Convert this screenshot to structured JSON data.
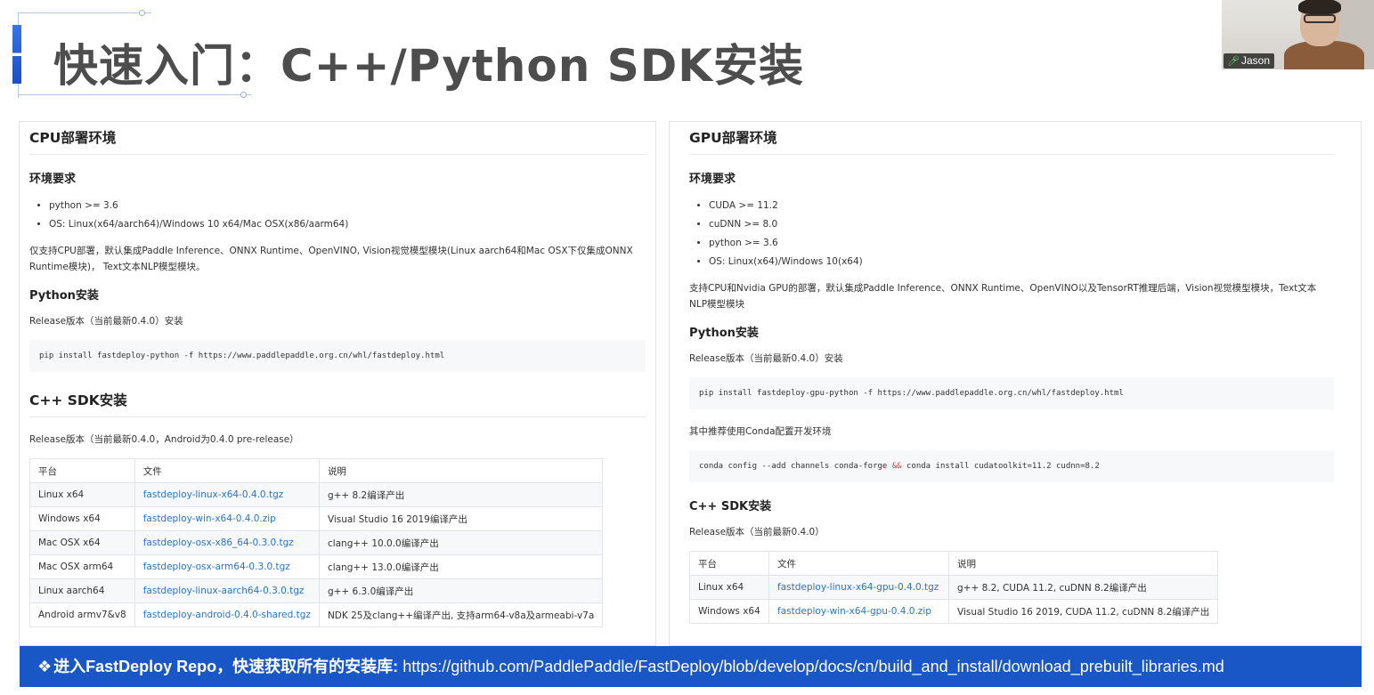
{
  "page": {
    "title": "快速入门：C++/Python SDK安装",
    "accent_color": "#1a57c6"
  },
  "webcam": {
    "participant_name": "Jason",
    "mic_icon": "mic-icon"
  },
  "cpu": {
    "heading": "CPU部署环境",
    "env_heading": "环境要求",
    "requirements": [
      "python >= 3.6",
      "OS: Linux(x64/aarch64)/Windows 10 x64/Mac OSX(x86/aarm64)"
    ],
    "description": "仅支持CPU部署，默认集成Paddle Inference、ONNX Runtime、OpenVINO, Vision视觉模型模块(Linux aarch64和Mac OSX下仅集成ONNX Runtime模块)， Text文本NLP模型模块。",
    "python_heading": "Python安装",
    "python_release": "Release版本（当前最新0.4.0）安装",
    "python_cmd": "pip install fastdeploy-python -f https://www.paddlepaddle.org.cn/whl/fastdeploy.html",
    "cpp_heading": "C++ SDK安装",
    "cpp_release": "Release版本（当前最新0.4.0，Android为0.4.0 pre-release）",
    "table_headers": [
      "平台",
      "文件",
      "说明"
    ],
    "table_rows": [
      [
        "Linux x64",
        "fastdeploy-linux-x64-0.4.0.tgz",
        "g++ 8.2编译产出"
      ],
      [
        "Windows x64",
        "fastdeploy-win-x64-0.4.0.zip",
        "Visual Studio 16 2019编译产出"
      ],
      [
        "Mac OSX x64",
        "fastdeploy-osx-x86_64-0.3.0.tgz",
        "clang++ 10.0.0编译产出"
      ],
      [
        "Mac OSX arm64",
        "fastdeploy-osx-arm64-0.3.0.tgz",
        "clang++ 13.0.0编译产出"
      ],
      [
        "Linux aarch64",
        "fastdeploy-linux-aarch64-0.3.0.tgz",
        "g++ 6.3.0编译产出"
      ],
      [
        "Android armv7&v8",
        "fastdeploy-android-0.4.0-shared.tgz",
        "NDK 25及clang++编译产出, 支持arm64-v8a及armeabi-v7a"
      ]
    ]
  },
  "gpu": {
    "heading": "GPU部署环境",
    "env_heading": "环境要求",
    "requirements": [
      "CUDA >= 11.2",
      "cuDNN >= 8.0",
      "python >= 3.6",
      "OS: Linux(x64)/Windows 10(x64)"
    ],
    "description": "支持CPU和Nvidia GPU的部署，默认集成Paddle Inference、ONNX Runtime、OpenVINO以及TensorRT推理后端，Vision视觉模型模块，Text文本NLP模型模块",
    "python_heading": "Python安装",
    "python_release": "Release版本（当前最新0.4.0）安装",
    "python_cmd": "pip install fastdeploy-gpu-python -f https://www.paddlepaddle.org.cn/whl/fastdeploy.html",
    "conda_note": "其中推荐使用Conda配置开发环境",
    "conda_cmd_a": "conda config --add channels conda-forge ",
    "conda_cmd_amp": "&&",
    "conda_cmd_b": " conda install cudatoolkit=11.2 cudnn=8.2",
    "cpp_heading": "C++ SDK安装",
    "cpp_release": "Release版本（当前最新0.4.0）",
    "table_headers": [
      "平台",
      "文件",
      "说明"
    ],
    "table_rows": [
      [
        "Linux x64",
        "fastdeploy-linux-x64-gpu-0.4.0.tgz",
        "g++ 8.2, CUDA 11.2, cuDNN 8.2编译产出"
      ],
      [
        "Windows x64",
        "fastdeploy-win-x64-gpu-0.4.0.zip",
        "Visual Studio 16 2019, CUDA 11.2, cuDNN 8.2编译产出"
      ]
    ]
  },
  "banner": {
    "pin_icon": "pin-icon",
    "lead": "进入FastDeploy Repo，快速获取所有的安装库:",
    "url": "https://github.com/PaddlePaddle/FastDeploy/blob/develop/docs/cn/build_and_install/download_prebuilt_libraries.md"
  }
}
